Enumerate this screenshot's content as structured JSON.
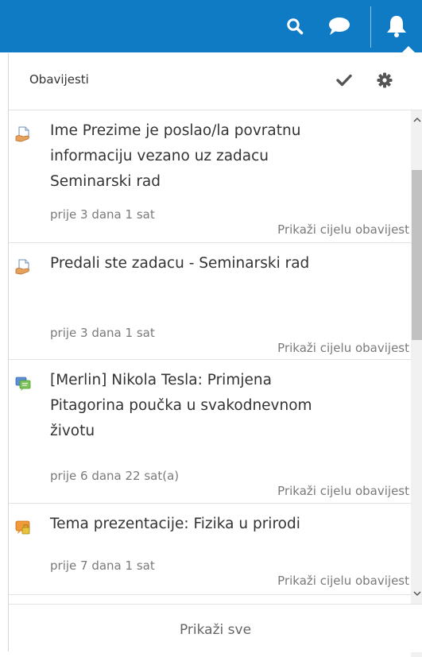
{
  "topbar": {
    "color": "#0f7bc4",
    "icons": [
      "search-icon",
      "chat-icon",
      "bell-icon"
    ]
  },
  "header": {
    "title": "Obavijesti",
    "icons": [
      "check-icon",
      "gear-icon"
    ]
  },
  "notifications": [
    {
      "icon": "assign-icon",
      "title": "Ime Prezime je poslao/la povratnu informaciju vezano uz zadacu Seminarski rad",
      "time": "prije 3 dana 1 sat",
      "link": "Prikaži cijelu obavijest"
    },
    {
      "icon": "assign-icon",
      "title": "Predali ste zadacu - Seminarski rad",
      "time": "prije 3 dana 1 sat",
      "link": "Prikaži cijelu obavijest"
    },
    {
      "icon": "forum-icon",
      "title": "[Merlin] Nikola Tesla: Primjena Pitagorina poučka u svakodnevnom životu",
      "time": "prije 6 dana 22 sat(a)",
      "link": "Prikaži cijelu obavijest"
    },
    {
      "icon": "chat-lock-icon",
      "title": "Tema prezentacije: Fizika u prirodi",
      "time": "prije 7 dana 1 sat",
      "link": "Prikaži cijelu obavijest"
    }
  ],
  "footer": {
    "link": "Prikaži sve"
  }
}
